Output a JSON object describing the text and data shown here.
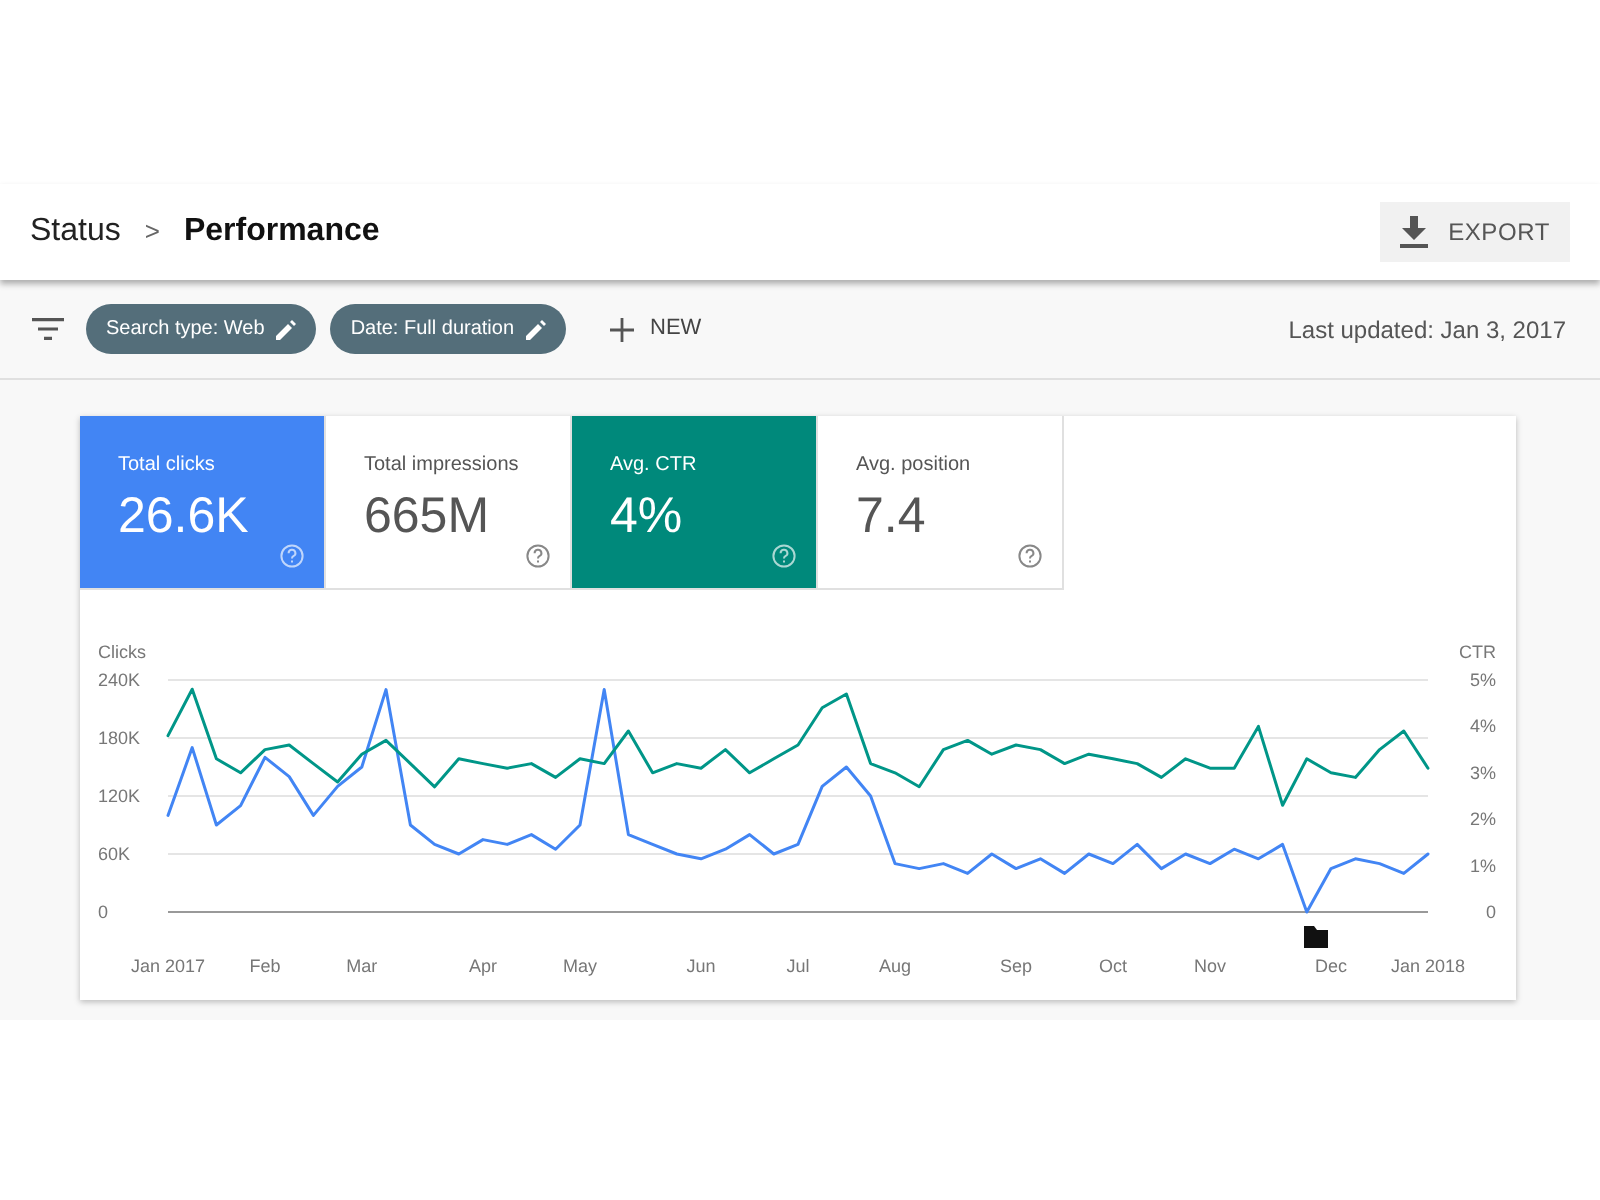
{
  "breadcrumb": {
    "parent": "Status",
    "separator": ">",
    "current": "Performance"
  },
  "export_button": {
    "label": "EXPORT"
  },
  "filters": [
    {
      "label": "Search type: Web"
    },
    {
      "label": "Date: Full duration"
    }
  ],
  "new_button": {
    "label": "NEW"
  },
  "last_updated": "Last updated: Jan 3, 2017",
  "metrics": [
    {
      "label": "Total clicks",
      "value": "26.6K",
      "selected": true,
      "color": "#4285f4"
    },
    {
      "label": "Total impressions",
      "value": "665M",
      "selected": false
    },
    {
      "label": "Avg. CTR",
      "value": "4%",
      "selected": true,
      "color": "#00897b"
    },
    {
      "label": "Avg. position",
      "value": "7.4",
      "selected": false
    }
  ],
  "chart_data": {
    "type": "line",
    "ylabel": "Clicks",
    "y2label": "CTR",
    "grid": true,
    "ylim": [
      0,
      240
    ],
    "y2lim": [
      0,
      5
    ],
    "categories": [
      "Jan 2017",
      null,
      null,
      null,
      "Feb",
      null,
      null,
      null,
      "Mar",
      null,
      null,
      null,
      null,
      "Apr",
      null,
      null,
      null,
      "May",
      null,
      null,
      null,
      null,
      "Jun",
      null,
      null,
      null,
      "Jul",
      null,
      null,
      null,
      "Aug",
      null,
      null,
      null,
      null,
      "Sep",
      null,
      null,
      null,
      "Oct",
      null,
      null,
      null,
      "Nov",
      null,
      null,
      null,
      null,
      "Dec",
      null,
      null,
      null,
      "Jan 2018"
    ],
    "yticks": [
      {
        "value": 0,
        "label": "0"
      },
      {
        "value": 60,
        "label": "60K"
      },
      {
        "value": 120,
        "label": "120K"
      },
      {
        "value": 180,
        "label": "180K"
      },
      {
        "value": 240,
        "label": "240K"
      }
    ],
    "y2ticks": [
      {
        "value": 0,
        "label": "0"
      },
      {
        "value": 1,
        "label": "1%"
      },
      {
        "value": 2,
        "label": "2%"
      },
      {
        "value": 3,
        "label": "3%"
      },
      {
        "value": 4,
        "label": "4%"
      },
      {
        "value": 5,
        "label": "5%"
      }
    ],
    "series": [
      {
        "color": "#4285f4",
        "values": [
          100,
          170,
          90,
          110,
          160,
          140,
          100,
          130,
          150,
          230,
          90,
          70,
          60,
          75,
          70,
          80,
          65,
          90,
          230,
          80,
          70,
          60,
          55,
          65,
          80,
          60,
          70,
          130,
          150,
          120,
          50,
          45,
          50,
          40,
          60,
          45,
          55,
          40,
          60,
          50,
          70,
          45,
          60,
          50,
          65,
          55,
          70,
          0,
          45,
          55,
          50,
          40,
          60
        ]
      },
      {
        "axis": "y2",
        "color": "#009688",
        "values": [
          3.8,
          4.8,
          3.3,
          3.0,
          3.5,
          3.6,
          3.2,
          2.8,
          3.4,
          3.7,
          3.2,
          2.7,
          3.3,
          3.2,
          3.1,
          3.2,
          2.9,
          3.3,
          3.2,
          3.9,
          3.0,
          3.2,
          3.1,
          3.5,
          3.0,
          3.3,
          3.6,
          4.4,
          4.7,
          3.2,
          3.0,
          2.7,
          3.5,
          3.7,
          3.4,
          3.6,
          3.5,
          3.2,
          3.4,
          3.3,
          3.2,
          2.9,
          3.3,
          3.1,
          3.1,
          4.0,
          2.3,
          3.3,
          3.0,
          2.9,
          3.5,
          3.9,
          3.1
        ]
      }
    ]
  }
}
